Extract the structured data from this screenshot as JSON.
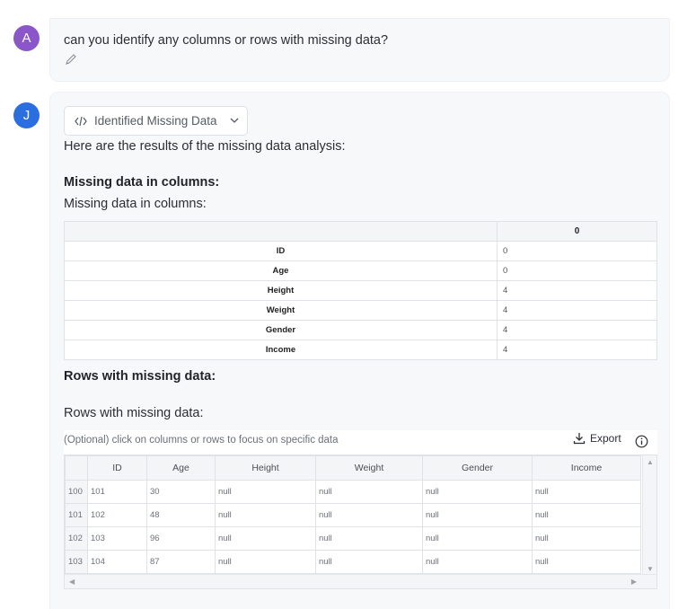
{
  "user_message": {
    "avatar": "A",
    "text": "can you identify any columns or rows with missing data?",
    "edit_icon": "pencil-icon"
  },
  "assistant_message": {
    "avatar": "J",
    "code_chip": {
      "label": "Identified Missing Data",
      "icon": "code-icon",
      "chevron": "chevron-down-icon"
    },
    "intro": "Here are the results of the missing data analysis:",
    "section1_heading": "Missing data in columns:",
    "section1_text": "Missing data in columns:",
    "missing_table": {
      "header": "0",
      "rows": [
        {
          "label": "ID",
          "value": "0"
        },
        {
          "label": "Age",
          "value": "0"
        },
        {
          "label": "Height",
          "value": "4"
        },
        {
          "label": "Weight",
          "value": "4"
        },
        {
          "label": "Gender",
          "value": "4"
        },
        {
          "label": "Income",
          "value": "4"
        }
      ]
    },
    "section2_heading": "Rows with missing data:",
    "section2_text": "Rows with missing data:",
    "grid": {
      "hint": "(Optional) click on columns or rows to focus on specific data",
      "export_label": "Export",
      "columns": [
        "ID",
        "Age",
        "Height",
        "Weight",
        "Gender",
        "Income"
      ],
      "rows": [
        {
          "index": "100",
          "cells": [
            "101",
            "30",
            "null",
            "null",
            "null",
            "null"
          ]
        },
        {
          "index": "101",
          "cells": [
            "102",
            "48",
            "null",
            "null",
            "null",
            "null"
          ]
        },
        {
          "index": "102",
          "cells": [
            "103",
            "96",
            "null",
            "null",
            "null",
            "null"
          ]
        },
        {
          "index": "103",
          "cells": [
            "104",
            "87",
            "null",
            "null",
            "null",
            "null"
          ]
        }
      ]
    }
  },
  "colors": {
    "avatar_user": "#8a56c9",
    "avatar_assistant": "#2a6ee0",
    "bubble": "#f7f8fa"
  }
}
